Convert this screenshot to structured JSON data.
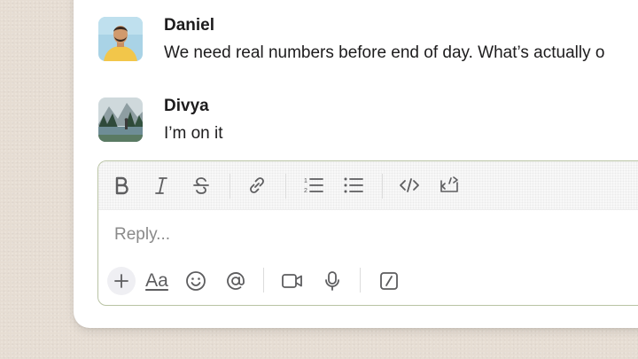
{
  "messages": [
    {
      "author": "Daniel",
      "text": "We need real numbers before end of day. What’s actually o",
      "avatar": "person-avatar"
    },
    {
      "author": "Divya",
      "text": "I’m on it",
      "avatar": "landscape-avatar"
    }
  ],
  "composer": {
    "placeholder": "Reply...",
    "toolbar": [
      "bold-icon",
      "italic-icon",
      "strikethrough-icon",
      "link-icon",
      "ordered-list-icon",
      "bulleted-list-icon",
      "code-icon",
      "code-block-icon"
    ],
    "actions": [
      "plus-icon",
      "formatting-icon",
      "emoji-icon",
      "mention-icon",
      "video-icon",
      "microphone-icon",
      "slash-command-icon"
    ],
    "formatting_label": "Aa"
  },
  "colors": {
    "background": "#e6ddd3",
    "card": "#ffffff",
    "composer_border": "#b9c3a4",
    "icon": "#5d5d5f",
    "placeholder": "#8a8a8a"
  }
}
